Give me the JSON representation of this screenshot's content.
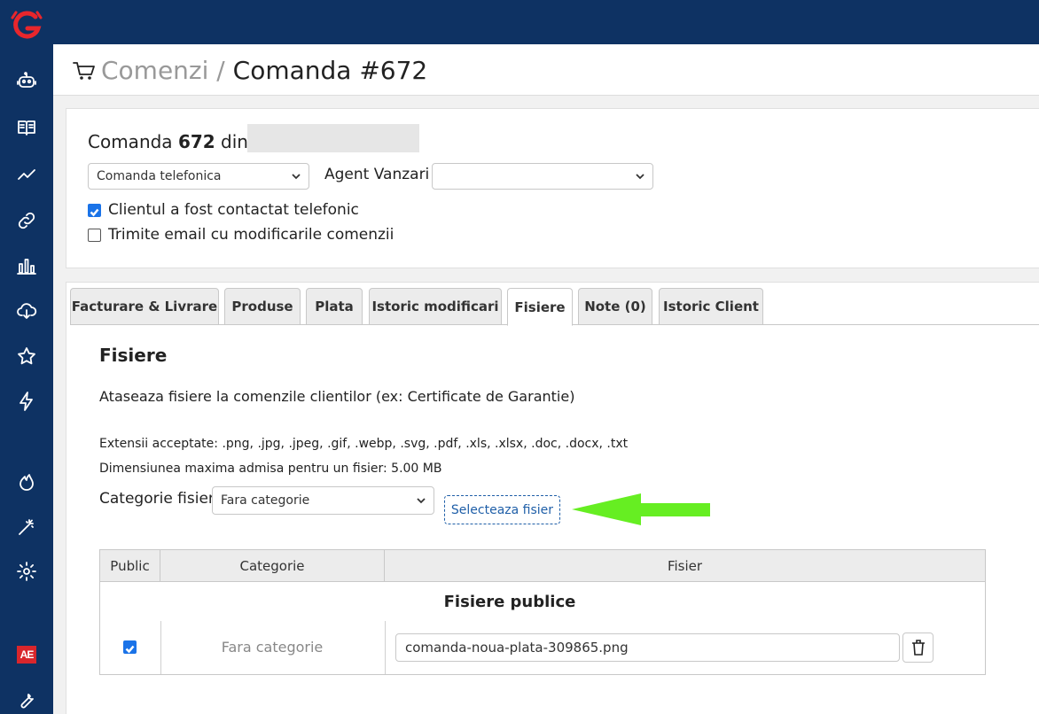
{
  "app": {
    "sidebar_icons": [
      "robot-icon",
      "book-icon",
      "trend-icon",
      "link-icon",
      "bar-chart-icon",
      "cloud-download-icon",
      "star-icon",
      "bolt-icon",
      "flame-icon",
      "magic-wand-icon",
      "gear-icon",
      "ae-badge-icon",
      "wrench-icon"
    ],
    "ae_badge": "AE",
    "colors": {
      "sidebar": "#0e3263",
      "accent": "#1f5fa8",
      "arrow": "#66ee22"
    }
  },
  "header": {
    "breadcrumb_parent": "Comenzi",
    "breadcrumb_sep": " / ",
    "breadcrumb_current": "Comanda #672"
  },
  "order": {
    "title_prefix": "Comanda ",
    "number": "672",
    "title_suffix": " din",
    "source_select": "Comanda telefonica",
    "agent_label": "Agent Vanzari",
    "agent_select": "",
    "contacted_label": "Clientul a fost contactat telefonic",
    "contacted_checked": true,
    "email_label": "Trimite email cu modificarile comenzii",
    "email_checked": false
  },
  "tabs": [
    {
      "label": "Facturare & Livrare",
      "active": false
    },
    {
      "label": "Produse",
      "active": false
    },
    {
      "label": "Plata",
      "active": false
    },
    {
      "label": "Istoric modificari",
      "active": false
    },
    {
      "label": "Fisiere",
      "active": true
    },
    {
      "label": "Note (0)",
      "active": false
    },
    {
      "label": "Istoric Client",
      "active": false
    }
  ],
  "files": {
    "heading": "Fisiere",
    "description": "Ataseaza fisiere la comenzile clientilor (ex: Certificate de Garantie)",
    "extensions": "Extensii acceptate: .png, .jpg, .jpeg, .gif, .webp, .svg, .pdf, .xls, .xlsx, .doc, .docx, .txt",
    "max_size": "Dimensiunea maxima admisa pentru un fisier: 5.00 MB",
    "category_label": "Categorie fisier",
    "category_select": "Fara categorie",
    "upload_button": "Selecteaza fisier",
    "table": {
      "headers": [
        "Public",
        "Categorie",
        "Fisier"
      ],
      "group_title": "Fisiere publice",
      "rows": [
        {
          "public": true,
          "category": "Fara categorie",
          "file": "comanda-noua-plata-309865.png"
        }
      ]
    }
  }
}
